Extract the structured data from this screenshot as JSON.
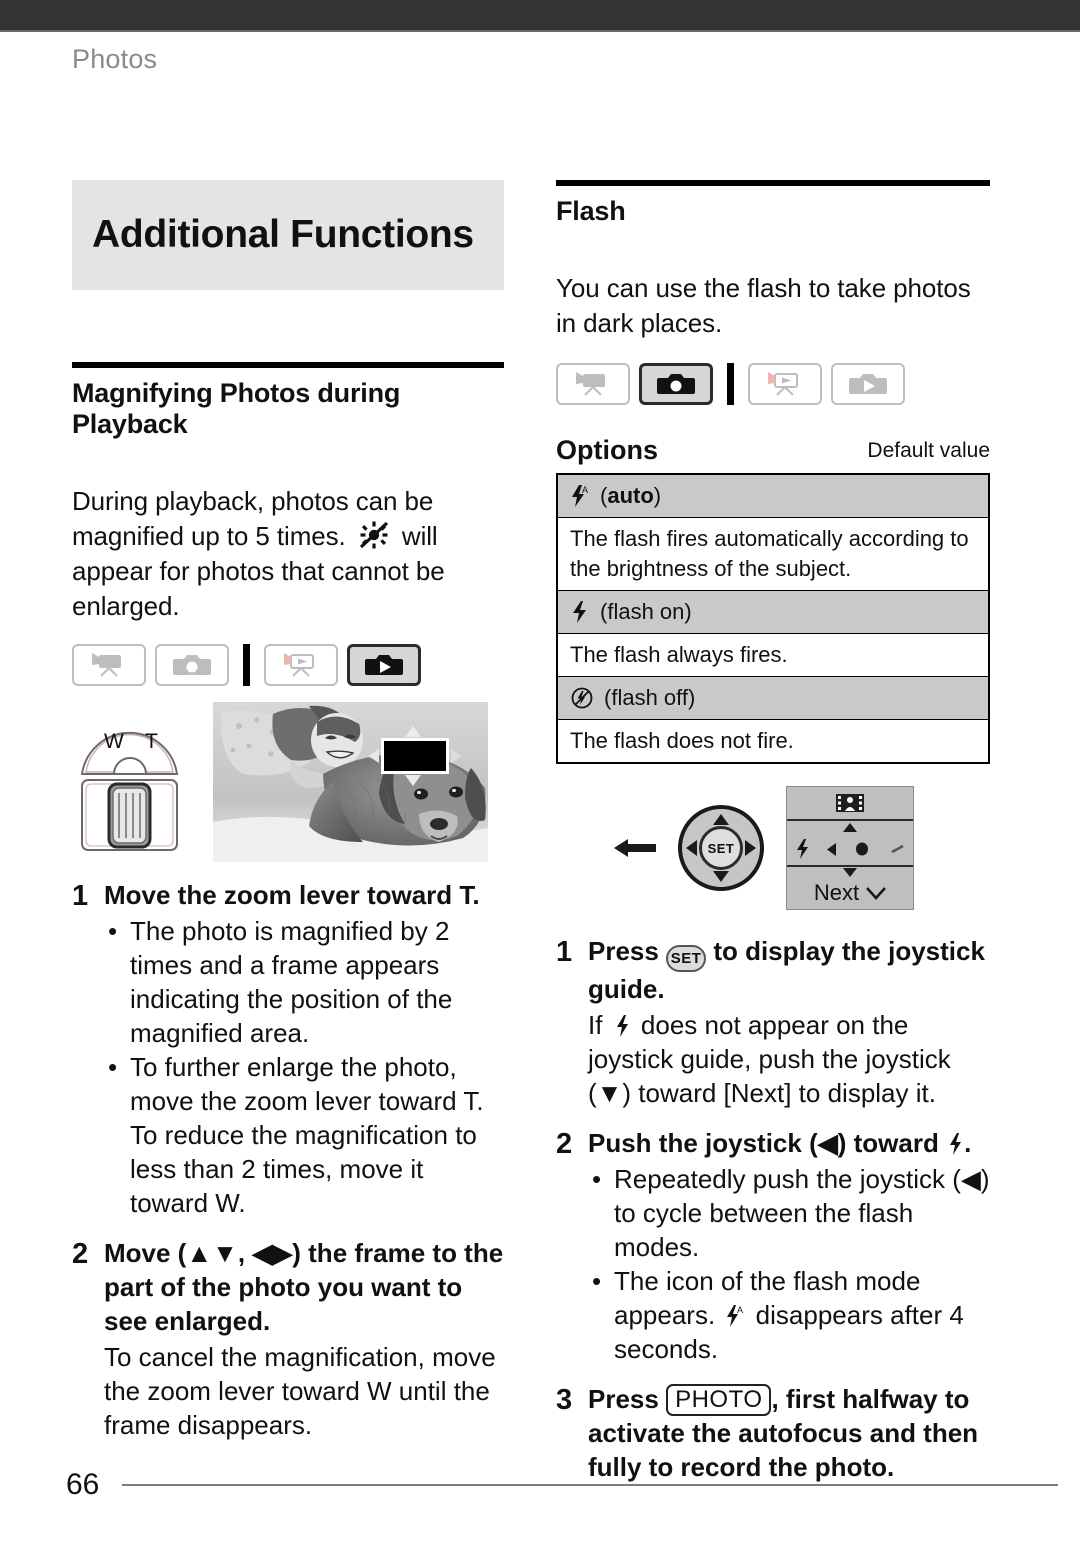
{
  "page": {
    "running_head": "Photos",
    "page_number": "66"
  },
  "left_column": {
    "chapter_title": "Additional Functions",
    "section": {
      "title": "Magnifying Photos during Playback",
      "intro_before_icon": "During playback, photos can be magnified up to 5 times.",
      "intro_icon": "no-magnify-icon",
      "intro_after_icon": "will appear for photos that cannot be enlarged.",
      "modes": [
        {
          "name": "camcorder-record-mode",
          "active": false
        },
        {
          "name": "camera-record-mode",
          "active": false
        },
        {
          "name": "camcorder-playback-mode",
          "active": false
        },
        {
          "name": "camera-playback-mode",
          "active": true
        }
      ],
      "illustration": {
        "zoom_lever_label_wide": "W",
        "zoom_lever_label_tele": "T",
        "photo_alt": "girl-with-dog-photo"
      },
      "steps": [
        {
          "number": "1",
          "title": "Move the zoom lever toward T.",
          "bullets": [
            "The photo is magnified by 2 times and a frame appears indicating the position of the magnified area.",
            "To further enlarge the photo, move the zoom lever toward T. To reduce the magnification to less than 2 times, move it toward W."
          ],
          "note": ""
        },
        {
          "number": "2",
          "title_part1": "Move (",
          "title_arrows1": "updown-arrows",
          "title_part2": ", ",
          "title_arrows2": "leftright-arrows",
          "title_part3": ") the frame to the part of the photo you want to see enlarged.",
          "note": "To cancel the magnification, move the zoom lever toward W until the frame disappears.",
          "bullets": []
        }
      ]
    }
  },
  "right_column": {
    "section": {
      "title": "Flash",
      "intro": "You can use the flash to take photos in dark places.",
      "modes": [
        {
          "name": "camcorder-record-mode",
          "active": false
        },
        {
          "name": "camera-record-mode",
          "active": true
        },
        {
          "name": "camcorder-playback-mode",
          "active": false
        },
        {
          "name": "camera-playback-mode",
          "active": false
        }
      ],
      "options": {
        "title": "Options",
        "default_label": "Default value",
        "rows": [
          {
            "icon": "flash-auto-icon",
            "name_prefix": "(",
            "name": "auto",
            "name_suffix": ")",
            "name_bold": true,
            "description": "The flash fires automatically according to the brightness of the subject."
          },
          {
            "icon": "flash-on-icon",
            "name_prefix": "(",
            "name": "flash on",
            "name_suffix": ")",
            "name_bold": false,
            "description": "The flash always fires."
          },
          {
            "icon": "flash-off-icon",
            "name_prefix": "(",
            "name": "flash off",
            "name_suffix": ")",
            "name_bold": false,
            "description": "The flash does not fire."
          }
        ]
      },
      "joystick_guide": {
        "set_label": "SET",
        "next_label": "Next",
        "top_icon": "film-strip-icon",
        "left_icon": "flash-icon"
      },
      "steps": [
        {
          "number": "1",
          "title_part1": "Press",
          "title_button": "SET",
          "title_part2": "to display the joystick guide.",
          "note_part1": "If",
          "note_icon": "flash-icon",
          "note_part2": "does not appear on the joystick guide, push the joystick (",
          "note_arrow": "down-arrow",
          "note_part3": ") toward [Next] to display it.",
          "bullets": []
        },
        {
          "number": "2",
          "title_part1": "Push the joystick (",
          "title_arrow": "left-arrow",
          "title_part2": ") toward",
          "title_icon": "flash-icon",
          "title_part3": ".",
          "bullets": [
            "Repeatedly push the joystick (◀) to cycle between the flash modes.",
            "The icon of the flash mode appears. ⚡ᴬ disappears after 4 seconds."
          ],
          "bullet1_part1": "Repeatedly push the joystick (",
          "bullet1_arrow": "left-arrow",
          "bullet1_part2": ") to cycle between the flash modes.",
          "bullet2_part1": "The icon of the flash mode appears.",
          "bullet2_icon": "flash-auto-icon",
          "bullet2_part2": "disappears after 4 seconds."
        },
        {
          "number": "3",
          "title_part1": "Press",
          "title_button": "PHOTO",
          "title_part2": ", first halfway to activate the autofocus and then fully to record the photo.",
          "bullets": []
        }
      ]
    }
  },
  "colors": {
    "top_bar": "#333333",
    "chapter_block_bg": "#e4e4e4",
    "table_header_bg": "#c9c9c9",
    "running_head": "#8a8a8a",
    "active_mode_bg": "#d6d6d6"
  }
}
